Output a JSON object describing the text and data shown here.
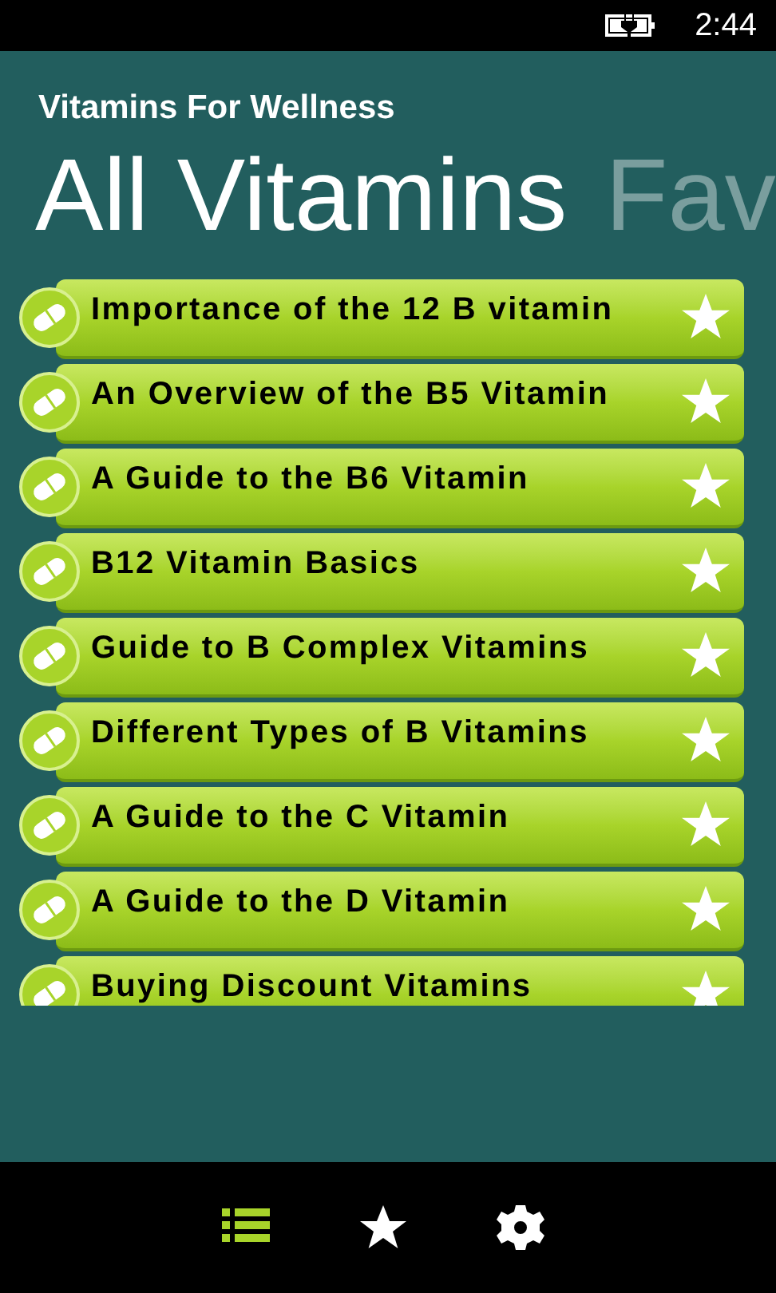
{
  "status_bar": {
    "time": "2:44"
  },
  "app_title": "Vitamins For Wellness",
  "pivot": [
    {
      "label": "All Vitamins",
      "selected": true
    },
    {
      "label": "Fav",
      "selected": false
    }
  ],
  "items": [
    {
      "title": "Importance of the 12 B vitamin"
    },
    {
      "title": "An Overview of the B5 Vitamin"
    },
    {
      "title": "A Guide to the B6 Vitamin"
    },
    {
      "title": "B12 Vitamin Basics"
    },
    {
      "title": "Guide to B Complex Vitamins"
    },
    {
      "title": "Different Types of B Vitamins"
    },
    {
      "title": "A Guide to the C Vitamin"
    },
    {
      "title": "A Guide to the D Vitamin"
    },
    {
      "title": "Buying Discount Vitamins"
    }
  ],
  "app_bar": [
    {
      "kind": "list",
      "selected": true
    },
    {
      "kind": "star",
      "selected": false
    },
    {
      "kind": "settings",
      "selected": false
    }
  ]
}
